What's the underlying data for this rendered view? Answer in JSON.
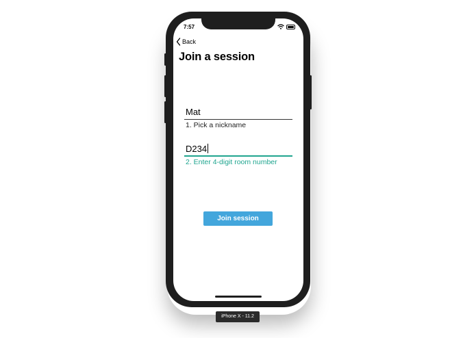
{
  "status_bar": {
    "time": "7:57",
    "icons": [
      "wifi-icon",
      "battery-icon"
    ]
  },
  "nav": {
    "back_label": "Back",
    "back_icon": "chevron-left-icon"
  },
  "page": {
    "title": "Join a session"
  },
  "form": {
    "nickname": {
      "value": "Mat",
      "label": "1. Pick a nickname"
    },
    "room": {
      "value": "D234",
      "label": "2. Enter 4-digit room number",
      "focused": true
    }
  },
  "actions": {
    "join_label": "Join session"
  },
  "simulator": {
    "device_label": "iPhone X - 11.2"
  },
  "colors": {
    "accent": "#1fa58f",
    "button": "#43a6dc",
    "device_frame": "#1e1e1e"
  }
}
